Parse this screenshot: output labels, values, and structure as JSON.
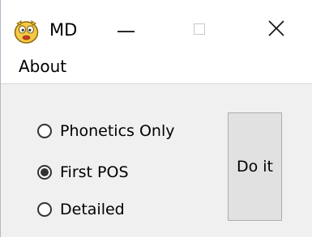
{
  "window": {
    "title": "MD",
    "app_icon": "smiley-face-icon",
    "controls": {
      "minimize_icon": "minimize-icon",
      "maximize_icon": "maximize-icon",
      "close_icon": "close-icon"
    }
  },
  "menubar": {
    "items": [
      {
        "label": "About"
      }
    ]
  },
  "options": {
    "items": [
      {
        "label": "Phonetics Only",
        "selected": false
      },
      {
        "label": "First POS",
        "selected": true
      },
      {
        "label": "Detailed",
        "selected": false
      }
    ]
  },
  "action": {
    "label": "Do it"
  },
  "colors": {
    "titlebar_background": "#ffffff",
    "window_background": "#f0f0f0",
    "button_face": "#e1e1e1",
    "button_border": "#adadad",
    "icon_face": "#f6c945"
  }
}
